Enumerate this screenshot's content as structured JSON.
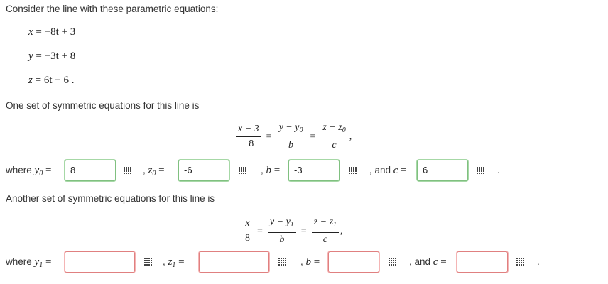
{
  "intro_text": "Consider the line with these parametric equations:",
  "param_eqs": {
    "x": {
      "lhs": "x",
      "rhs": "−8t + 3"
    },
    "y": {
      "lhs": "y",
      "rhs": "−3t + 8"
    },
    "z": {
      "lhs": "z",
      "rhs": "6t − 6",
      "end": "."
    }
  },
  "part1": {
    "heading": "One set of symmetric equations for this line is",
    "frac1": {
      "num": "x − 3",
      "den": "−8"
    },
    "frac2": {
      "num": "y − y",
      "num_sub": "0",
      "den": "b"
    },
    "frac3": {
      "num": "z − z",
      "num_sub": "0",
      "den": "c"
    },
    "eq_sign": "=",
    "trail": ",",
    "where": "where",
    "y0_label": "y",
    "y0_sub": "0",
    "y0_value": "8",
    "z0_label": "z",
    "z0_sub": "0",
    "z0_value": "-6",
    "b_label": "b",
    "b_value": "-3",
    "c_prefix": ", and",
    "c_label": "c",
    "c_value": "6",
    "end": "."
  },
  "part2": {
    "heading": "Another set of symmetric equations for this line is",
    "frac1": {
      "num": "x",
      "den": "8"
    },
    "frac2": {
      "num": "y − y",
      "num_sub": "1",
      "den": "b"
    },
    "frac3": {
      "num": "z − z",
      "num_sub": "1",
      "den": "c"
    },
    "eq_sign": "=",
    "trail": ",",
    "where": "where",
    "y1_label": "y",
    "y1_sub": "1",
    "y1_value": "",
    "z1_label": "z",
    "z1_sub": "1",
    "z1_value": "",
    "b_label": "b",
    "b_value": "",
    "c_prefix": ", and",
    "c_label": "c",
    "c_value": "",
    "end": "."
  },
  "common": {
    "comma": ",",
    "equals": "=",
    "keyboard_icon": "keyboard-icon"
  },
  "colors": {
    "correct_border": "#80c080",
    "incorrect_border": "#e08080"
  }
}
